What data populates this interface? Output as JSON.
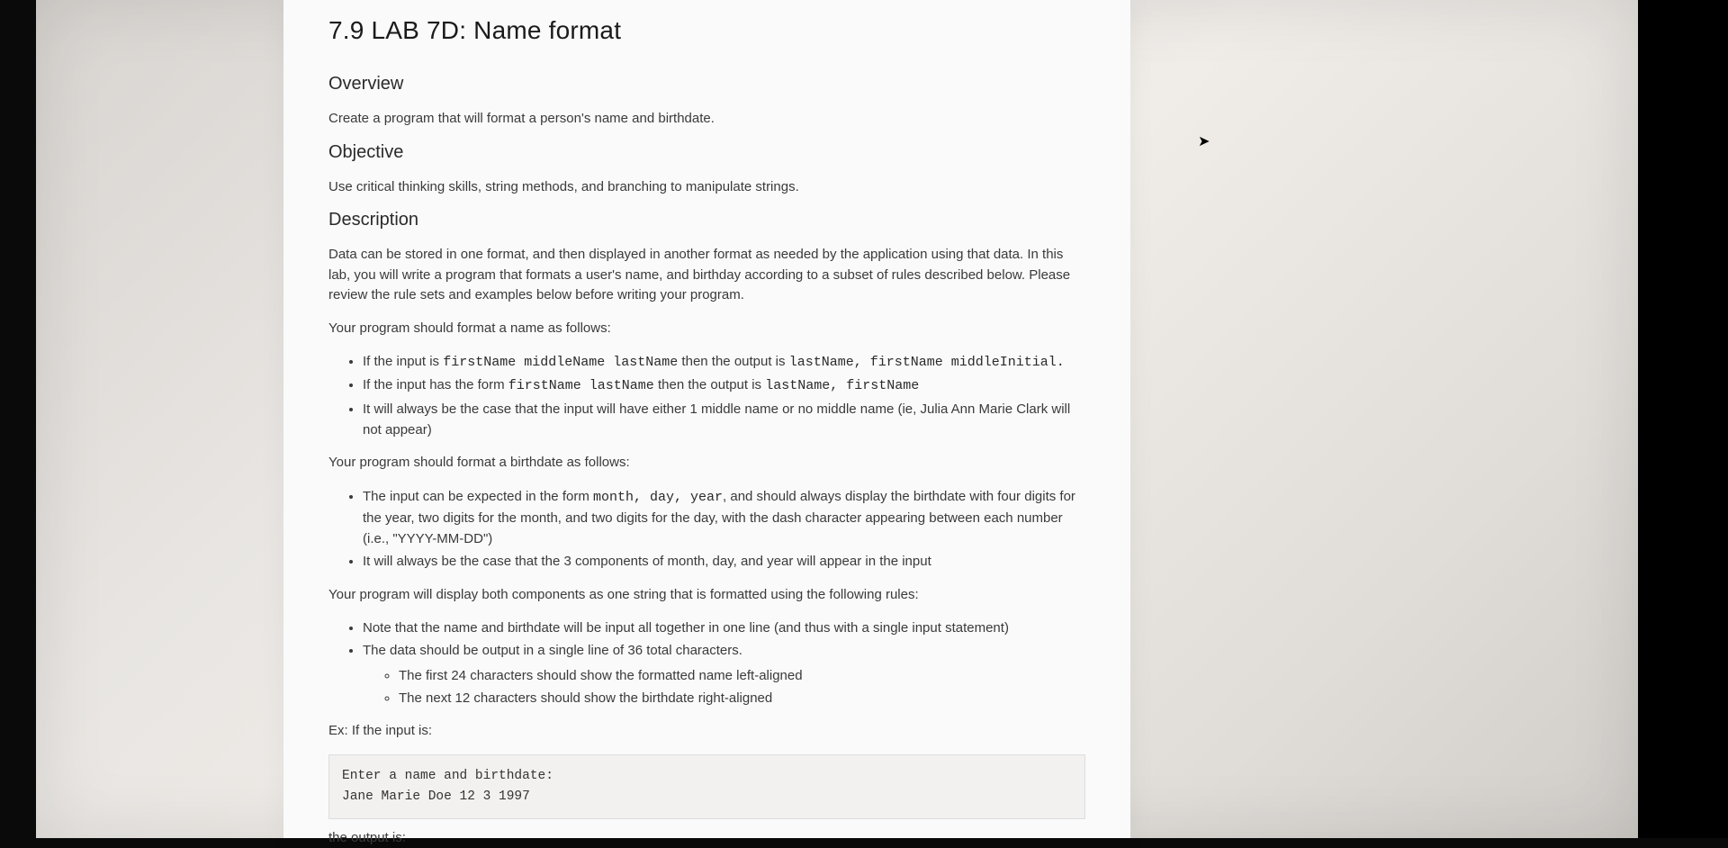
{
  "title": "7.9 LAB 7D: Name format",
  "sections": {
    "overview": {
      "heading": "Overview",
      "text": "Create a program that will format a person's name and birthdate."
    },
    "objective": {
      "heading": "Objective",
      "text": "Use critical thinking skills, string methods, and branching to manipulate strings."
    },
    "description": {
      "heading": "Description",
      "intro": "Data can be stored in one format, and then displayed in another format as needed by the application using that data. In this lab, you will write a program that formats a user's name, and birthday according to a subset of rules described below. Please review the rule sets and examples below before writing your program.",
      "name_rules_intro": "Your program should format a name as follows:",
      "name_rules": [
        {
          "pre": "If the input is ",
          "mono1": "firstName middleName lastName",
          "mid": " then the output is ",
          "mono2": "lastName, firstName middleInitial.",
          "post": ""
        },
        {
          "pre": "If the input has the form ",
          "mono1": "firstName lastName",
          "mid": " then the output is ",
          "mono2": "lastName, firstName",
          "post": ""
        },
        {
          "pre": "It will always be the case that the input will have either 1 middle name or no middle name (ie, Julia Ann Marie Clark will not appear)",
          "mono1": "",
          "mid": "",
          "mono2": "",
          "post": ""
        }
      ],
      "date_rules_intro": "Your program should format a birthdate as follows:",
      "date_rules": [
        {
          "text_a": "The input can be expected in the form ",
          "mono": "month, day, year",
          "text_b": ", and should always display the birthdate with four digits for the year, two digits for the month, and two digits for the day, with the dash character appearing between each number (i.e., \"YYYY-MM-DD\")"
        },
        {
          "text_a": "It will always be the case that the 3 components of month, day, and year will appear in the input",
          "mono": "",
          "text_b": ""
        }
      ],
      "combined_intro": "Your program will display both components as one string that is formatted using the following rules:",
      "combined_rules": [
        {
          "text": "Note that the name and birthdate will be input all together in one line (and thus with a single input statement)",
          "sub": []
        },
        {
          "text": "The data should be output in a single line of 36 total characters.",
          "sub": [
            "The first 24 characters should show the formatted name left-aligned",
            "The next 12 characters should show the birthdate right-aligned"
          ]
        }
      ],
      "example_intro": "Ex: If the input is:",
      "example_code": "Enter a name and birthdate:\nJane Marie Doe 12 3 1997",
      "output_intro": "the output is:"
    }
  }
}
